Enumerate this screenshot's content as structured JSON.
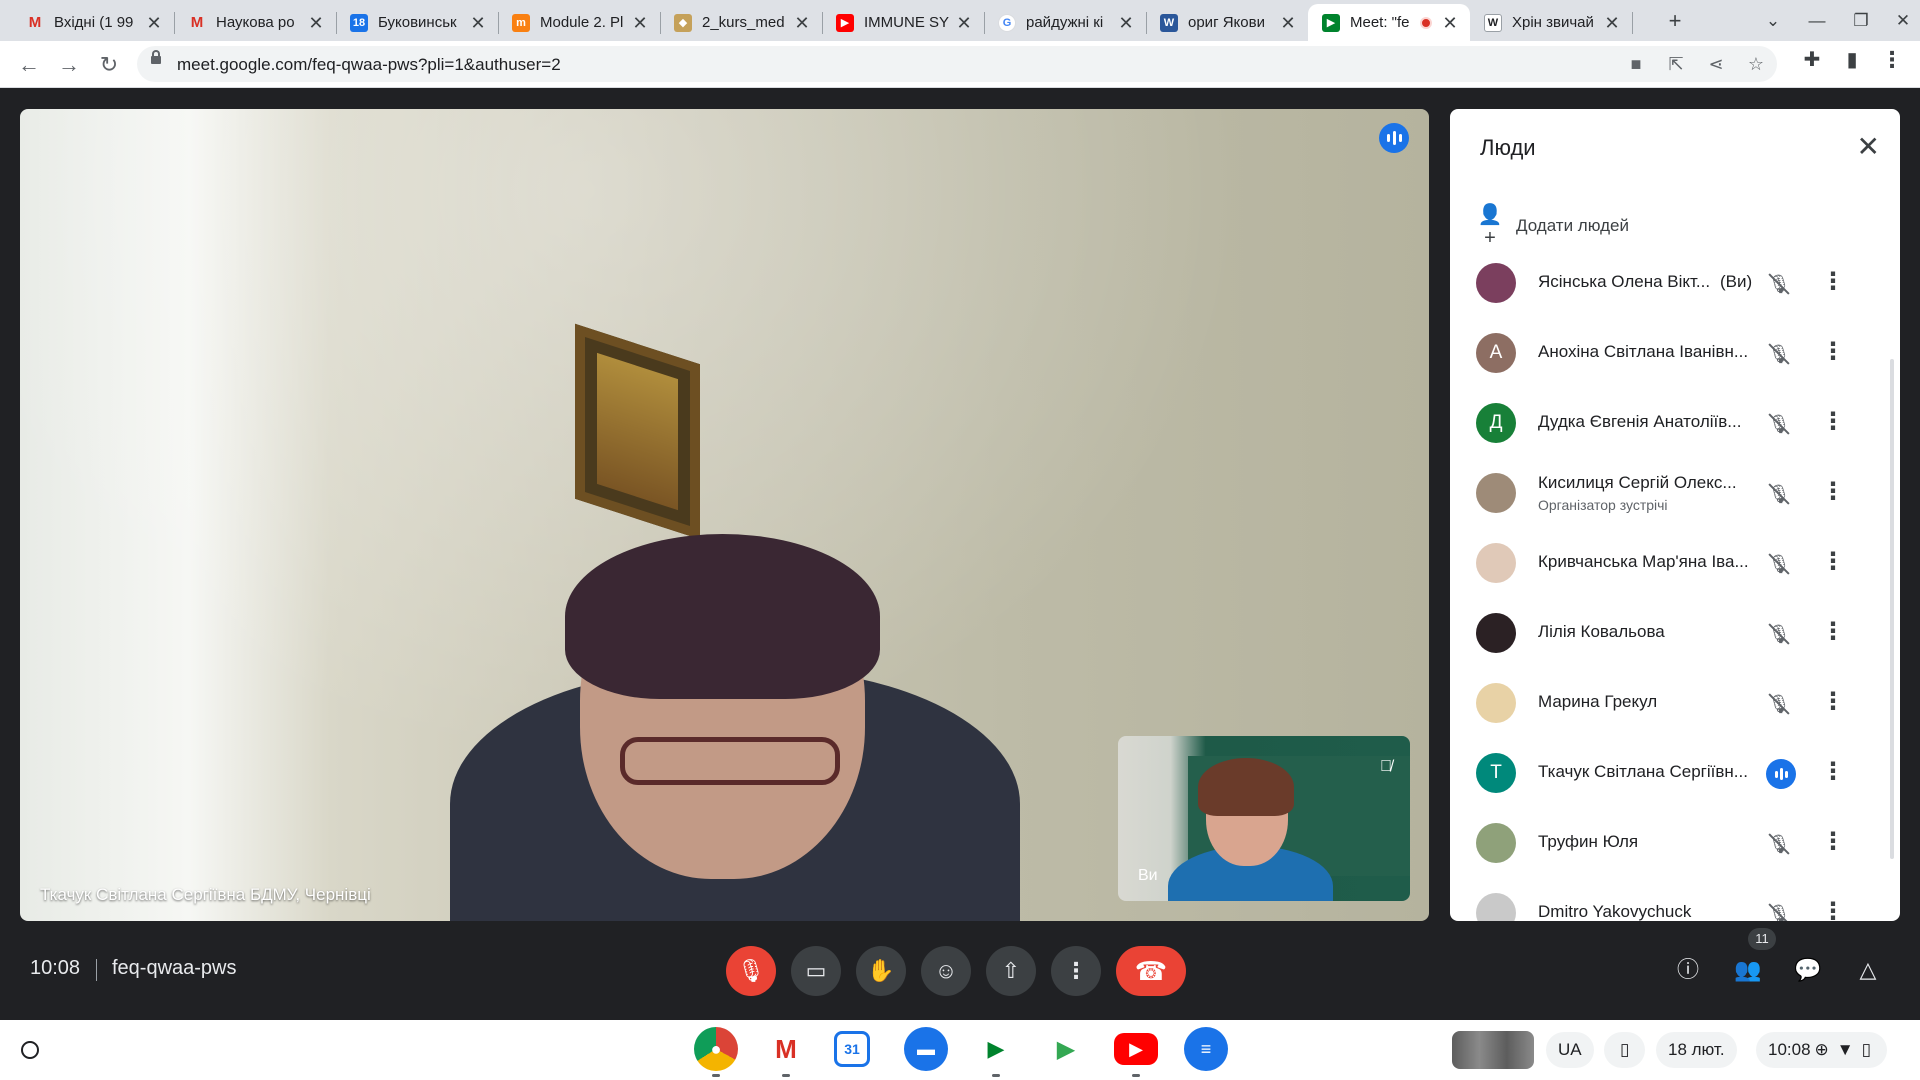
{
  "browser": {
    "tabs": [
      {
        "title": "Вхідні (1 99",
        "favicon": "gmail-icon"
      },
      {
        "title": "Наукова ро",
        "favicon": "gmail-icon"
      },
      {
        "title": "Буковинськ",
        "favicon": "calendar-icon",
        "favicon_text": "18"
      },
      {
        "title": "Module 2. Pl",
        "favicon": "moodle-icon"
      },
      {
        "title": "2_kurs_med",
        "favicon": "shield-icon"
      },
      {
        "title": "IMMUNE SY",
        "favicon": "youtube-icon"
      },
      {
        "title": "райдужні кі",
        "favicon": "google-icon",
        "favicon_text": "G"
      },
      {
        "title": "ориг Якови",
        "favicon": "word-icon",
        "favicon_text": "W"
      },
      {
        "title": "Meet: \"fe",
        "favicon": "meet-icon",
        "active": true,
        "recording": true
      },
      {
        "title": "Хрін звичай",
        "favicon": "wikipedia-icon",
        "favicon_text": "W"
      }
    ],
    "new_tab_symbol": "+",
    "close_symbol": "✕",
    "url": "meet.google.com/feq-qwaa-pws?pli=1&authuser=2"
  },
  "meet": {
    "main_speaker_label": "Ткачук Світлана Сергіївна БДМУ, Чернівці",
    "self_label": "Ви",
    "clock": "10:08",
    "meeting_code": "feq-qwaa-pws",
    "participant_count": "11"
  },
  "people_panel": {
    "title": "Люди",
    "add_people": "Додати людей",
    "you_suffix": "(Ви)",
    "participants": [
      {
        "name": "Ясінська Олена Вікт...",
        "you": true,
        "avatar_color": "#7b3f5e",
        "avatar_letter": ""
      },
      {
        "name": "Анохіна Світлана Іванівн...",
        "avatar_color": "#8d6e63",
        "avatar_letter": "А"
      },
      {
        "name": "Дудка Євгенія Анатоліїв...",
        "avatar_color": "#188038",
        "avatar_letter": "Д"
      },
      {
        "name": "Кисилиця Сергій Олекс...",
        "subtitle": "Організатор зустрічі",
        "avatar_color": "#9e8b78",
        "avatar_letter": ""
      },
      {
        "name": "Кривчанська Мар'яна Іва...",
        "avatar_color": "#e0c9b8",
        "avatar_letter": ""
      },
      {
        "name": "Лілія Ковальова",
        "avatar_color": "#2b2124",
        "avatar_letter": ""
      },
      {
        "name": "Марина Грекул",
        "avatar_color": "#e8d2a6",
        "avatar_letter": ""
      },
      {
        "name": "Ткачук Світлана Сергіївн...",
        "avatar_color": "#00897b",
        "avatar_letter": "Т",
        "speaking": true
      },
      {
        "name": "Труфин Юля",
        "avatar_color": "#8fa17a",
        "avatar_letter": ""
      },
      {
        "name": "Dmitro Yakovychuck",
        "avatar_color": "#c9c9c9",
        "avatar_letter": ""
      }
    ]
  },
  "shelf": {
    "apps": [
      "chrome-icon",
      "gmail-icon",
      "calendar-icon",
      "files-icon",
      "meet-icon",
      "play-store-icon",
      "youtube-icon",
      "messages-icon"
    ],
    "calendar_day": "31",
    "keyboard_layout": "UA",
    "date": "18 лют.",
    "time": "10:08"
  },
  "colors": {
    "meet_dark": "#202124",
    "accent_blue": "#1a73e8",
    "hangup_red": "#ea4335"
  }
}
